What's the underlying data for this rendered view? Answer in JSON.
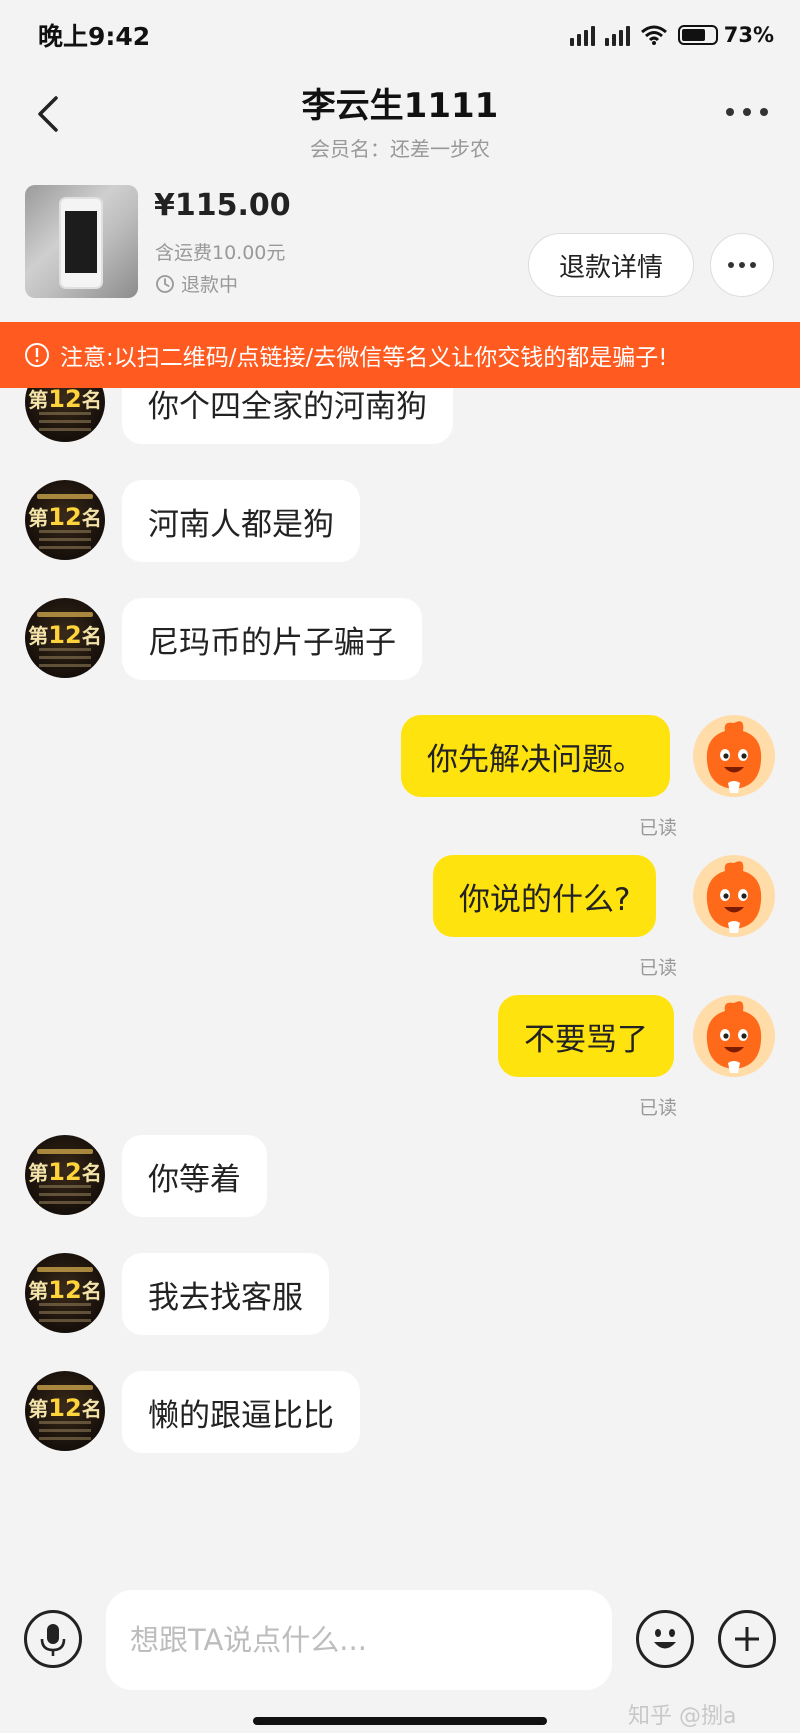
{
  "status_bar": {
    "time": "晚上9:42",
    "battery_percent": "73%",
    "battery_level": 0.73
  },
  "header": {
    "title": "李云生1111",
    "subtitle": "会员名：还差一步农",
    "icons": {
      "back": "chevron-left-icon",
      "more": "more-horizontal-icon"
    }
  },
  "product": {
    "price": "¥115.00",
    "shipping": "含运费10.00元",
    "status": "退款中",
    "refund_button": "退款详情"
  },
  "warning": {
    "text": "注意:以扫二维码/点链接/去微信等名义让你交钱的都是骗子!"
  },
  "avatar_other_text": {
    "rank": "第",
    "num": "12",
    "unit": "名"
  },
  "messages": [
    {
      "from": "other",
      "text": "你个四全家的河南狗"
    },
    {
      "from": "other",
      "text": "河南人都是狗"
    },
    {
      "from": "other",
      "text": "尼玛币的片子骗子"
    },
    {
      "from": "self",
      "text": "你先解决问题。",
      "status": "已读"
    },
    {
      "from": "self",
      "text": "你说的什么?",
      "status": "已读"
    },
    {
      "from": "self",
      "text": "不要骂了",
      "status": "已读"
    },
    {
      "from": "other",
      "text": "你等着"
    },
    {
      "from": "other",
      "text": "我去找客服"
    },
    {
      "from": "other",
      "text": "懒的跟逼比比"
    }
  ],
  "input": {
    "placeholder": "想跟TA说点什么...",
    "value": ""
  },
  "watermark": "知乎 @捌a",
  "colors": {
    "warning_bg": "#ff5a1f",
    "self_bubble": "#ffe30f",
    "other_bubble": "#ffffff",
    "background": "#f3f3f3"
  }
}
